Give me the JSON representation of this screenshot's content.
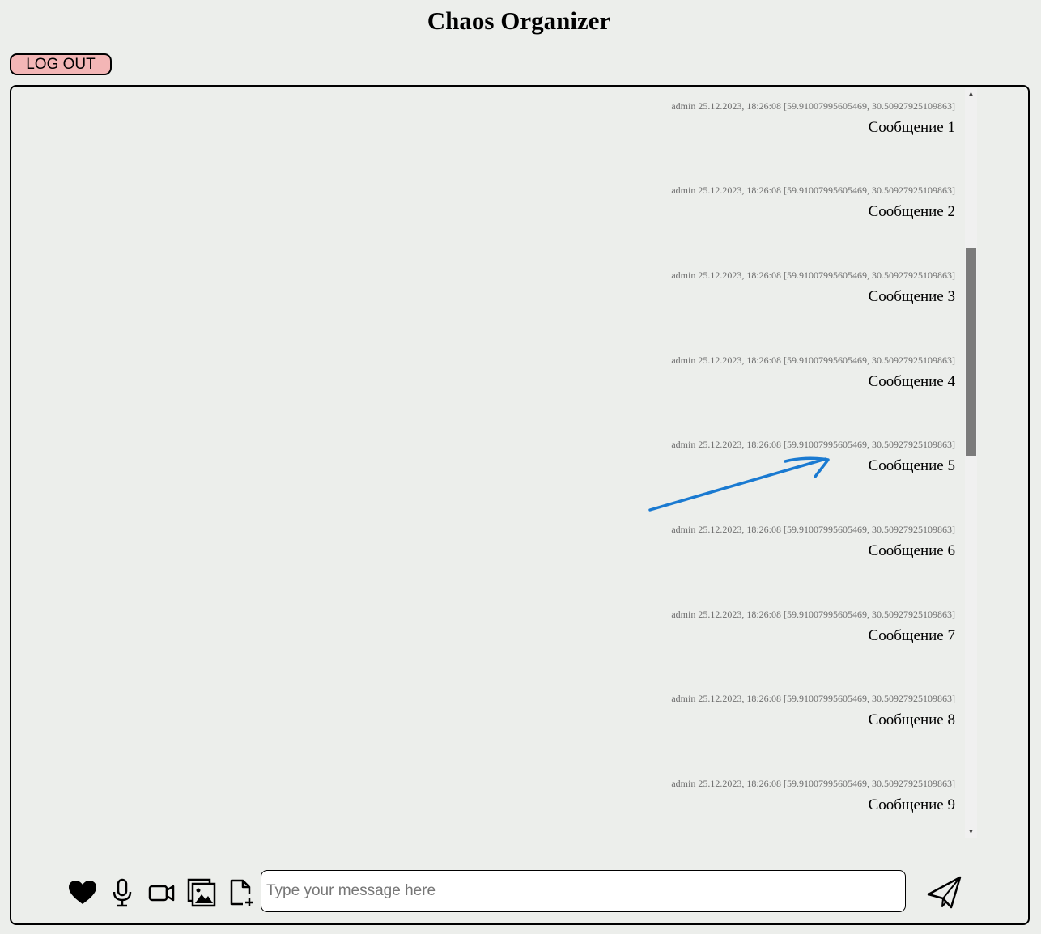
{
  "app": {
    "title": "Chaos Organizer"
  },
  "header": {
    "logout_label": "LOG OUT"
  },
  "messages": [
    {
      "meta": "admin 25.12.2023, 18:26:08 [59.91007995605469, 30.50927925109863]",
      "text": "Сообщение 1"
    },
    {
      "meta": "admin 25.12.2023, 18:26:08 [59.91007995605469, 30.50927925109863]",
      "text": "Сообщение 2"
    },
    {
      "meta": "admin 25.12.2023, 18:26:08 [59.91007995605469, 30.50927925109863]",
      "text": "Сообщение 3"
    },
    {
      "meta": "admin 25.12.2023, 18:26:08 [59.91007995605469, 30.50927925109863]",
      "text": "Сообщение 4"
    },
    {
      "meta": "admin 25.12.2023, 18:26:08 [59.91007995605469, 30.50927925109863]",
      "text": "Сообщение 5"
    },
    {
      "meta": "admin 25.12.2023, 18:26:08 [59.91007995605469, 30.50927925109863]",
      "text": "Сообщение 6"
    },
    {
      "meta": "admin 25.12.2023, 18:26:08 [59.91007995605469, 30.50927925109863]",
      "text": "Сообщение 7"
    },
    {
      "meta": "admin 25.12.2023, 18:26:08 [59.91007995605469, 30.50927925109863]",
      "text": "Сообщение 8"
    },
    {
      "meta": "admin 25.12.2023, 18:26:08 [59.91007995605469, 30.50927925109863]",
      "text": "Сообщение 9"
    }
  ],
  "composer": {
    "placeholder": "Type your message here"
  },
  "toolbar": {
    "icons": [
      "heart-icon",
      "microphone-icon",
      "video-camera-icon",
      "images-icon",
      "file-add-icon",
      "send-icon"
    ]
  },
  "colors": {
    "background": "#eceeeb",
    "logout_bg": "#f3b6b6",
    "annotation_arrow": "#1a7ad1",
    "scroll_thumb": "#7b7b7b"
  }
}
